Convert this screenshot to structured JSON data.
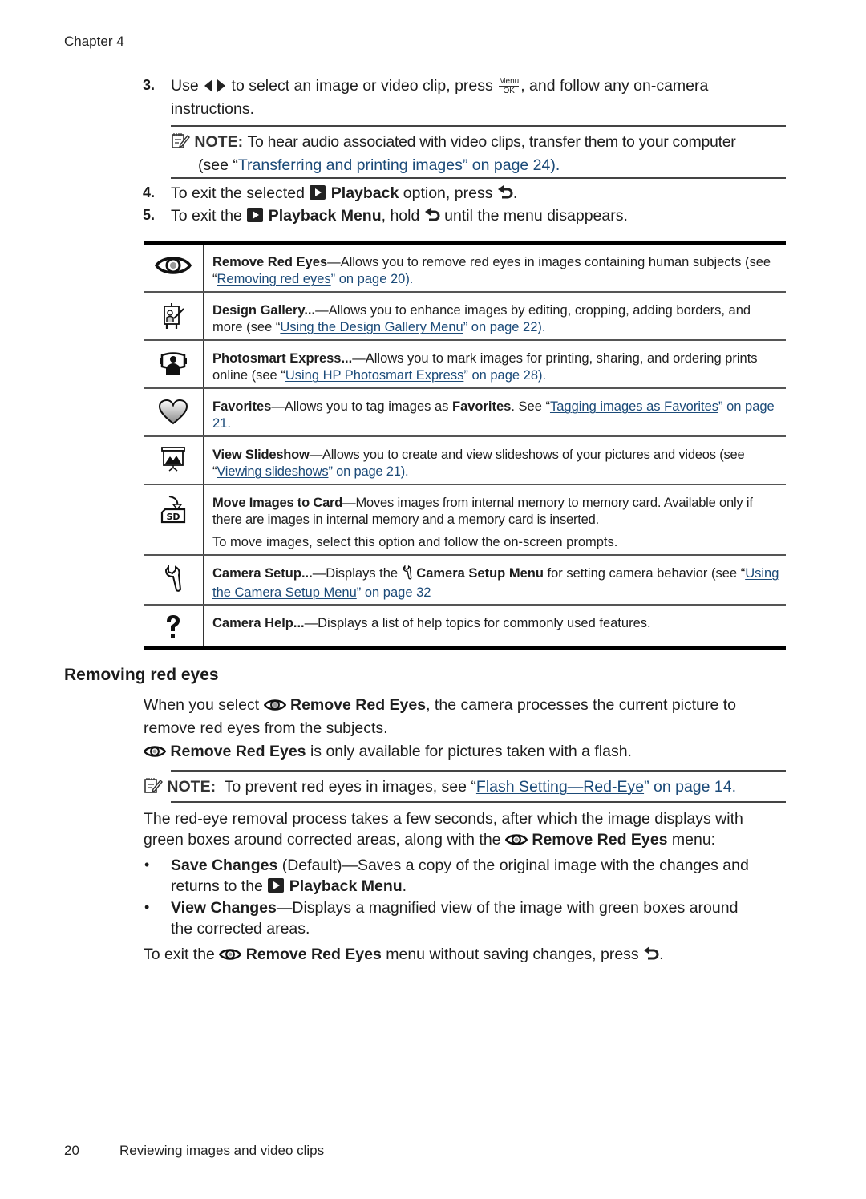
{
  "header": {
    "chapter": "Chapter 4"
  },
  "steps": {
    "s3": {
      "num": "3.",
      "pre": "Use",
      "mid": "to select an image or video clip, press",
      "menu_key_top": "Menu",
      "menu_key_bottom": "OK",
      "post": ", and follow any on-camera",
      "line2": "instructions."
    },
    "note1": {
      "label": "NOTE:",
      "text": "To hear audio associated with video clips, transfer them to your computer",
      "line2_pre": "(see “",
      "link": "Transferring and printing images",
      "line2_post": "” on page 24)."
    },
    "s4": {
      "num": "4.",
      "pre": "To exit the selected",
      "bold": "Playback",
      "post": "option, press",
      "end": "."
    },
    "s5": {
      "num": "5.",
      "pre": "To exit the",
      "bold": "Playback Menu",
      "post": ", hold",
      "end": "until the menu disappears."
    }
  },
  "table": {
    "rows": [
      {
        "icon": "eye-icon",
        "title": "Remove Red Eyes",
        "desc": "—Allows you to remove red eyes in images containing human subjects (see “",
        "link": "Removing red eyes",
        "after": "” on page 20)."
      },
      {
        "icon": "design-gallery-icon",
        "title": "Design Gallery...",
        "desc": "—Allows you to enhance images by editing, cropping, adding borders, and more (see “",
        "link": "Using the Design Gallery Menu",
        "after": "” on page 22)."
      },
      {
        "icon": "photosmart-express-icon",
        "title": "Photosmart Express...",
        "desc": "—Allows you to mark images for printing, sharing, and ordering prints online (see “",
        "link": "Using HP Photosmart Express",
        "after": "” on page 28)."
      },
      {
        "icon": "heart-icon",
        "title": "Favorites",
        "desc": "—Allows you to tag images as ",
        "desc_bold": "Favorites",
        "desc2": ". See “",
        "link": "Tagging images as Favorites",
        "after": "” on page 21."
      },
      {
        "icon": "slideshow-icon",
        "title": "View Slideshow",
        "desc": "—Allows you to create and view slideshows of your pictures and videos (see “",
        "link": "Viewing slideshows",
        "after": "” on page 21)."
      },
      {
        "icon": "sd-card-icon",
        "title": "Move Images to Card",
        "desc": "—Moves images from internal memory to memory card. Available only if there are images in internal memory and a memory card is inserted.",
        "extra": "To move images, select this option and follow the on-screen prompts."
      },
      {
        "icon": "wrench-icon",
        "title": "Camera Setup...",
        "desc": "—Displays the ",
        "desc_bold": "Camera Setup Menu",
        "desc2": " for setting camera behavior (see “",
        "link": "Using the Camera Setup Menu",
        "after": "” on page 32"
      },
      {
        "icon": "help-icon",
        "title": "Camera Help...",
        "desc": "—Displays a list of help topics for commonly used features."
      }
    ]
  },
  "section": {
    "title": "Removing red eyes",
    "p1_pre": "When you select",
    "p1_bold": "Remove Red Eyes",
    "p1_post": ", the camera processes the current picture to",
    "p1_line2": "remove red eyes from the subjects.",
    "p2_bold": "Remove Red Eyes",
    "p2_post": "is only available for pictures taken with a flash.",
    "note": {
      "label": "NOTE:",
      "pre": "To prevent red eyes in images, see “",
      "link": "Flash Setting—Red-Eye",
      "post": "” on page 14."
    },
    "p3_line1": "The red-eye removal process takes a few seconds, after which the image displays with",
    "p3_line2_pre": "green boxes around corrected areas, along with the",
    "p3_bold": "Remove Red Eyes",
    "p3_post": "menu:",
    "bullets": [
      {
        "bold": "Save Changes",
        "text": " (Default)—Saves a copy of the original image with the changes and",
        "line2_pre": "returns to the",
        "line2_bold": "Playback Menu",
        "line2_post": "."
      },
      {
        "bold": "View Changes",
        "text": "—Displays a magnified view of the image with green boxes around",
        "line2": "the corrected areas."
      }
    ],
    "p4_pre": "To exit the",
    "p4_bold": "Remove Red Eyes",
    "p4_post": "menu without saving changes, press",
    "p4_end": "."
  },
  "footer": {
    "page": "20",
    "title": "Reviewing images and video clips"
  }
}
